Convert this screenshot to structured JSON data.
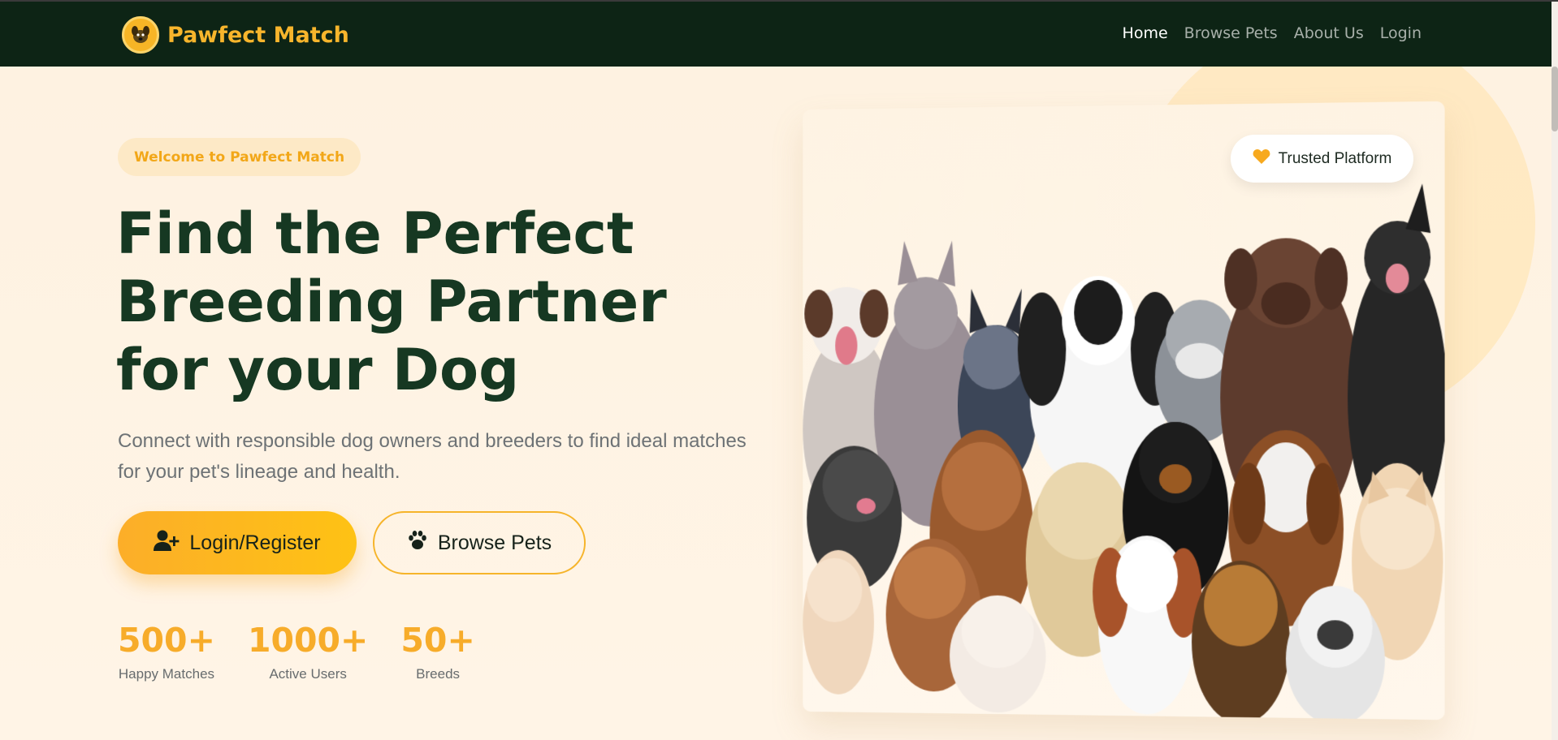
{
  "brand": {
    "name": "Pawfect Match",
    "logo_icon": "dog-icon"
  },
  "nav": {
    "items": [
      {
        "label": "Home",
        "active": true
      },
      {
        "label": "Browse Pets",
        "active": false
      },
      {
        "label": "About Us",
        "active": false
      },
      {
        "label": "Login",
        "active": false
      }
    ]
  },
  "hero": {
    "badge": "Welcome to Pawfect Match",
    "headline": "Find the Perfect Breeding Partner for your Dog",
    "subtitle": "Connect with responsible dog owners and breeders to find ideal matches for your pet's lineage and health.",
    "primary_button": {
      "label": "Login/Register",
      "icon": "user-plus-icon"
    },
    "secondary_button": {
      "label": "Browse Pets",
      "icon": "paw-icon"
    },
    "stats": [
      {
        "value": "500+",
        "label": "Happy Matches"
      },
      {
        "value": "1000+",
        "label": "Active Users"
      },
      {
        "value": "50+",
        "label": "Breeds"
      }
    ]
  },
  "trusted_badge": {
    "label": "Trusted Platform",
    "icon": "heart-icon"
  },
  "colors": {
    "nav_bg": "#0d2415",
    "accent": "#f7b52c",
    "headline": "#163822",
    "page_bg": "#fef3e2"
  }
}
